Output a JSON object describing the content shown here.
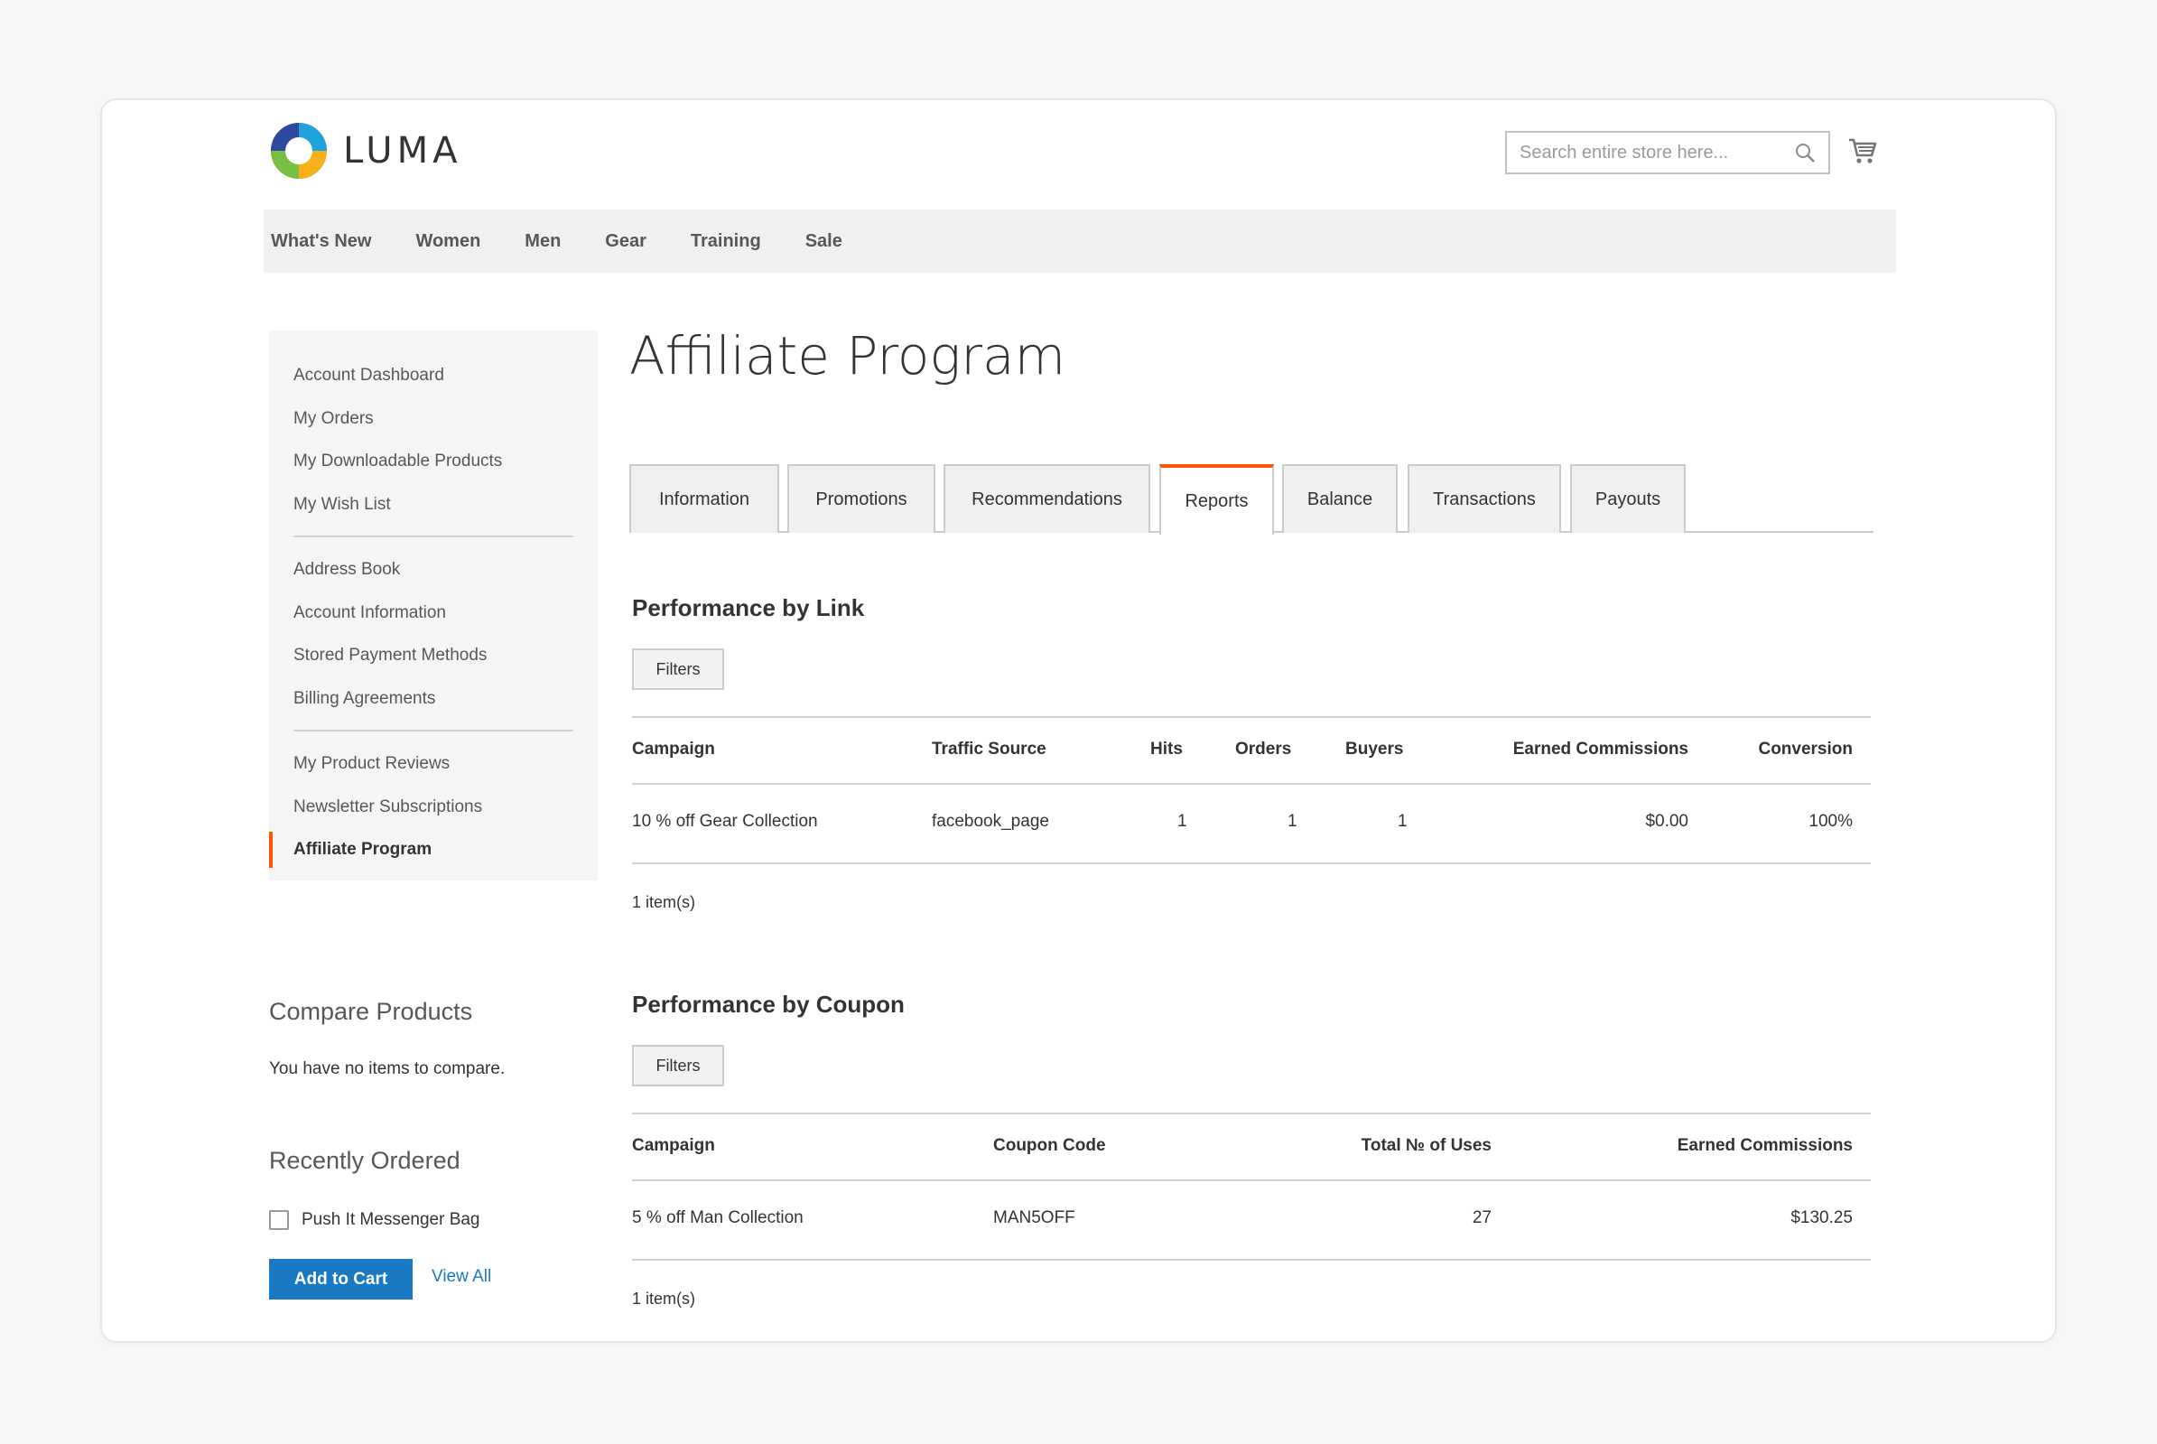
{
  "header": {
    "logo_text": "LUMA",
    "search_placeholder": "Search entire store here...",
    "colors": {
      "brand_orange": "#ff5501",
      "link_blue": "#1979c3"
    }
  },
  "nav": {
    "items": [
      "What's New",
      "Women",
      "Men",
      "Gear",
      "Training",
      "Sale"
    ]
  },
  "sidebar": {
    "groups": [
      [
        "Account Dashboard",
        "My Orders",
        "My Downloadable Products",
        "My Wish List"
      ],
      [
        "Address Book",
        "Account Information",
        "Stored Payment Methods",
        "Billing Agreements"
      ],
      [
        "My Product Reviews",
        "Newsletter Subscriptions",
        "Affiliate Program"
      ]
    ],
    "active": "Affiliate Program"
  },
  "compare": {
    "title": "Compare Products",
    "empty_text": "You have no items to compare."
  },
  "recent": {
    "title": "Recently Ordered",
    "item_label": "Push It Messenger Bag",
    "add_to_cart": "Add to Cart",
    "view_all": "View All"
  },
  "main": {
    "title": "Affiliate Program",
    "tabs": [
      "Information",
      "Promotions",
      "Recommendations",
      "Reports",
      "Balance",
      "Transactions",
      "Payouts"
    ],
    "active_tab": "Reports",
    "link_section": {
      "title": "Performance by Link",
      "filter_label": "Filters",
      "headers": [
        "Campaign",
        "Traffic Source",
        "Hits",
        "Orders",
        "Buyers",
        "Earned Commissions",
        "Conversion"
      ],
      "rows": [
        [
          "10 % off Gear Collection",
          "facebook_page",
          "1",
          "1",
          "1",
          "$0.00",
          "100%"
        ]
      ],
      "count": "1 item(s)"
    },
    "coupon_section": {
      "title": "Performance by Coupon",
      "filter_label": "Filters",
      "headers": [
        "Campaign",
        "Coupon Code",
        "Total № of Uses",
        "Earned Commissions"
      ],
      "rows": [
        [
          "5 % off Man Collection",
          "MAN5OFF",
          "27",
          "$130.25"
        ]
      ],
      "count": "1 item(s)"
    }
  }
}
